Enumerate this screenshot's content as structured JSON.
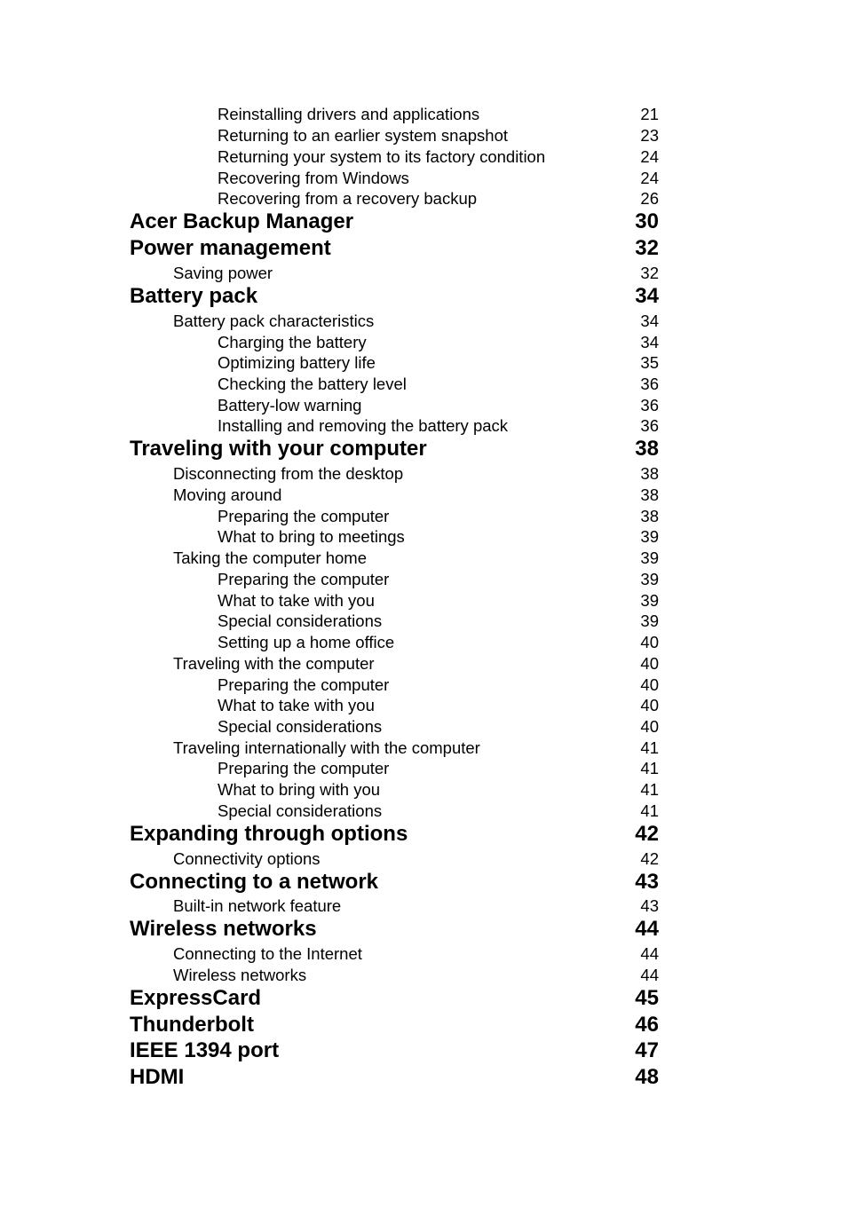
{
  "toc": {
    "entries": [
      {
        "level": 3,
        "title": "Reinstalling drivers and applications",
        "page": "21"
      },
      {
        "level": 3,
        "title": "Returning to an earlier system snapshot",
        "page": "23"
      },
      {
        "level": 3,
        "title": "Returning your system to its factory condition",
        "page": "24"
      },
      {
        "level": 3,
        "title": "Recovering from Windows",
        "page": "24"
      },
      {
        "level": 3,
        "title": "Recovering from a recovery backup",
        "page": "26"
      },
      {
        "level": 1,
        "title": "Acer Backup Manager",
        "page": "30"
      },
      {
        "level": 1,
        "title": "Power management",
        "page": "32"
      },
      {
        "level": 2,
        "title": "Saving power",
        "page": "32"
      },
      {
        "level": 1,
        "title": "Battery pack",
        "page": "34"
      },
      {
        "level": 2,
        "title": "Battery pack characteristics",
        "page": "34"
      },
      {
        "level": 3,
        "title": "Charging the battery",
        "page": "34"
      },
      {
        "level": 3,
        "title": "Optimizing battery life",
        "page": "35"
      },
      {
        "level": 3,
        "title": "Checking the battery level",
        "page": "36"
      },
      {
        "level": 3,
        "title": "Battery-low warning",
        "page": "36"
      },
      {
        "level": 3,
        "title": "Installing and removing the battery pack",
        "page": "36"
      },
      {
        "level": 1,
        "title": "Traveling with your computer",
        "page": "38"
      },
      {
        "level": 2,
        "title": "Disconnecting from the desktop",
        "page": "38"
      },
      {
        "level": 2,
        "title": "Moving around",
        "page": "38"
      },
      {
        "level": 3,
        "title": "Preparing the computer",
        "page": "38"
      },
      {
        "level": 3,
        "title": "What to bring to meetings",
        "page": "39"
      },
      {
        "level": 2,
        "title": "Taking the computer home",
        "page": "39"
      },
      {
        "level": 3,
        "title": "Preparing the computer",
        "page": "39"
      },
      {
        "level": 3,
        "title": "What to take with you",
        "page": "39"
      },
      {
        "level": 3,
        "title": "Special considerations",
        "page": "39"
      },
      {
        "level": 3,
        "title": "Setting up a home office",
        "page": "40"
      },
      {
        "level": 2,
        "title": "Traveling with the computer",
        "page": "40"
      },
      {
        "level": 3,
        "title": "Preparing the computer",
        "page": "40"
      },
      {
        "level": 3,
        "title": "What to take with you",
        "page": "40"
      },
      {
        "level": 3,
        "title": "Special considerations",
        "page": "40"
      },
      {
        "level": 2,
        "title": "Traveling internationally with the computer",
        "page": "41"
      },
      {
        "level": 3,
        "title": "Preparing the computer",
        "page": "41"
      },
      {
        "level": 3,
        "title": "What to bring with you",
        "page": "41"
      },
      {
        "level": 3,
        "title": "Special considerations",
        "page": "41"
      },
      {
        "level": 1,
        "title": "Expanding through options",
        "page": "42"
      },
      {
        "level": 2,
        "title": "Connectivity options",
        "page": "42"
      },
      {
        "level": 1,
        "title": "Connecting to a network",
        "page": "43"
      },
      {
        "level": 2,
        "title": "Built-in network feature",
        "page": "43"
      },
      {
        "level": 1,
        "title": "Wireless networks",
        "page": "44"
      },
      {
        "level": 2,
        "title": "Connecting to the Internet",
        "page": "44"
      },
      {
        "level": 2,
        "title": "Wireless networks",
        "page": "44"
      },
      {
        "level": 1,
        "title": "ExpressCard",
        "page": "45"
      },
      {
        "level": 1,
        "title": "Thunderbolt",
        "page": "46"
      },
      {
        "level": 1,
        "title": "IEEE 1394 port",
        "page": "47"
      },
      {
        "level": 1,
        "title": "HDMI",
        "page": "48"
      }
    ]
  }
}
